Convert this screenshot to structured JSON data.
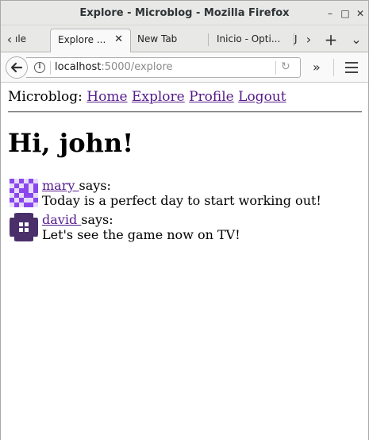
{
  "window": {
    "title": "Explore - Microblog - Mozilla Firefox"
  },
  "tabs": [
    {
      "label": "ıle"
    },
    {
      "label": "Explore ..."
    },
    {
      "label": "New Tab"
    },
    {
      "label": "Inicio - Opti..."
    },
    {
      "label": "J"
    }
  ],
  "navbar": {
    "url_host": "localhost",
    "url_path": ":5000/explore"
  },
  "site": {
    "brand": "Microblog:",
    "nav": [
      {
        "label": "Home"
      },
      {
        "label": "Explore"
      },
      {
        "label": "Profile"
      },
      {
        "label": "Logout"
      }
    ],
    "greeting": "Hi, john!"
  },
  "posts": [
    {
      "author": "mary ",
      "says": " says:",
      "body": "Today is a perfect day to start working out!",
      "avatar_color": "#8a47ee"
    },
    {
      "author": "david ",
      "says": " says:",
      "body": "Let's see the game now on TV!",
      "avatar_color": "#4a2f6a"
    }
  ],
  "icons": {
    "minimize": "minimize-icon",
    "maximize": "maximize-icon",
    "close": "close-icon",
    "back": "back-arrow-icon",
    "info": "info-icon",
    "reload": "reload-icon",
    "overflow": "double-chevron-icon",
    "menu": "hamburger-menu-icon"
  }
}
